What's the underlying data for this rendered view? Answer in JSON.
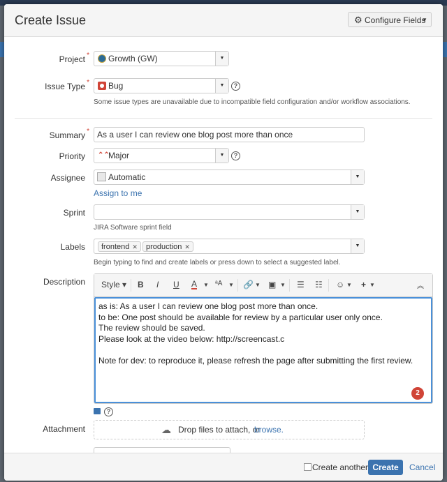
{
  "dialog": {
    "title": "Create Issue",
    "configure_fields": "Configure Fields"
  },
  "fields": {
    "project": {
      "label": "Project",
      "value": "Growth (GW)"
    },
    "issue_type": {
      "label": "Issue Type",
      "value": "Bug",
      "note": "Some issue types are unavailable due to incompatible field configuration and/or workflow associations."
    },
    "summary": {
      "label": "Summary",
      "value": "As a user I can review one blog post more than once"
    },
    "priority": {
      "label": "Priority",
      "value": "Major"
    },
    "assignee": {
      "label": "Assignee",
      "value": "Automatic",
      "assign_link": "Assign to me"
    },
    "sprint": {
      "label": "Sprint",
      "value": "",
      "note": "JIRA Software sprint field"
    },
    "labels": {
      "label": "Labels",
      "tags": [
        "frontend",
        "production"
      ],
      "note": "Begin typing to find and create labels or press down to select a suggested label."
    },
    "description": {
      "label": "Description",
      "toolbar": {
        "style": "Style",
        "bold": "B",
        "italic": "I",
        "underline": "U",
        "color": "A",
        "size": "ᵃA"
      },
      "lines": [
        "as is: As a user I can review one blog post more than once.",
        "to be: One post should be available for review by a particular user only once.",
        "The review should be saved.",
        "Please look at the video below: http://screencast.c",
        "",
        "Note for dev: to reproduce it, please refresh the page after submitting the first review."
      ],
      "badge": "2"
    },
    "attachment": {
      "label": "Attachment",
      "drop_text": "Drop files to attach, or ",
      "browse": "browse."
    }
  },
  "footer": {
    "create_another": "Create another",
    "create": "Create",
    "cancel": "Cancel"
  },
  "colors": {
    "accent": "#3b73af",
    "required": "#d04437",
    "focus": "#4a90d9"
  }
}
